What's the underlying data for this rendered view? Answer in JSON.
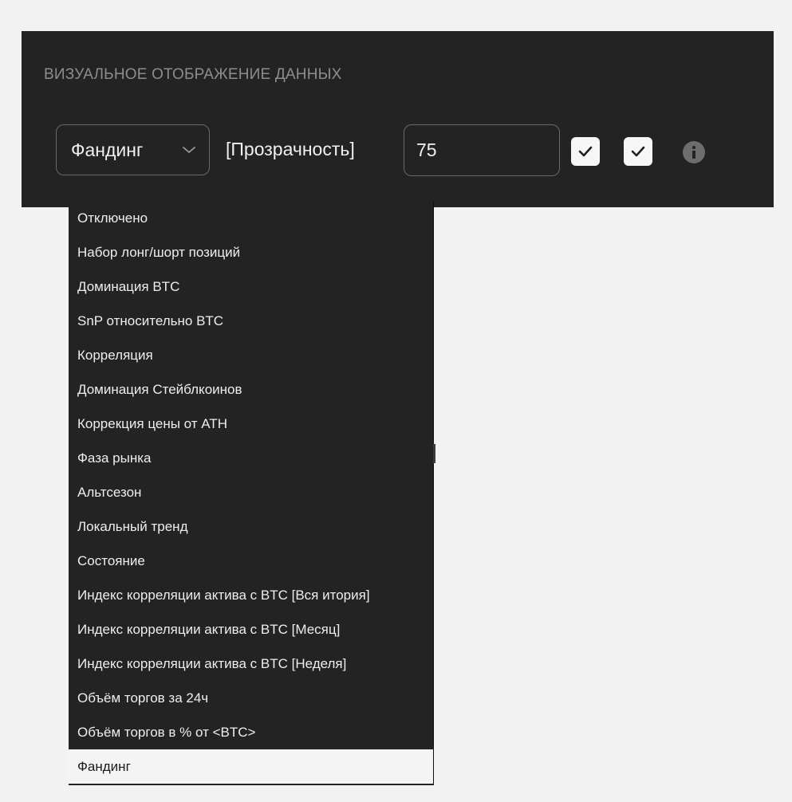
{
  "section": {
    "title": "ВИЗУАЛЬНОЕ ОТОБРАЖЕНИЕ ДАННЫХ"
  },
  "controls": {
    "select_value": "Фандинг",
    "chevron_icon": "chevron-down-icon",
    "opacity_label": "[Прозрачность]",
    "opacity_value": "75",
    "checkbox_1_checked": true,
    "checkbox_2_checked": true,
    "info_icon": "info-icon"
  },
  "dropdown": {
    "items": [
      "Отключено",
      "Набор лонг/шорт позиций",
      "Доминация BTC",
      "SnP относительно BTC",
      "Корреляция",
      "Доминация Стейблкоинов",
      "Коррекция цены от ATH",
      "Фаза рынка",
      "Альтсезон",
      "Локальный тренд",
      "Состояние",
      "Индекс корреляции актива с BTC [Вся итория]",
      "Индекс корреляции актива с BTC [Месяц]",
      "Индекс корреляции актива с BTC [Неделя]",
      "Объём торгов за 24ч",
      "Объём торгов в % от <BTC>",
      "Фандинг"
    ],
    "selected": "Фандинг"
  },
  "colors": {
    "panel_bg": "#232323",
    "page_bg": "#f2f2f2",
    "text_light": "#f0f0f0",
    "muted_title": "#8d8d8d",
    "selected_bg": "#f4f4f4"
  }
}
